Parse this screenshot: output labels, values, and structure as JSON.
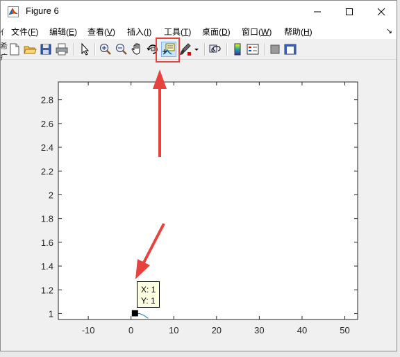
{
  "window": {
    "title": "Figure 6",
    "controls": {
      "minimize": "minimize",
      "maximize": "maximize",
      "close": "close"
    }
  },
  "menu": {
    "items": [
      {
        "label": "文件(",
        "key": "F",
        "end": ")"
      },
      {
        "label": "编辑(",
        "key": "E",
        "end": ")"
      },
      {
        "label": "查看(",
        "key": "V",
        "end": ")"
      },
      {
        "label": "插入(",
        "key": "I",
        "end": ")"
      },
      {
        "label": "工具(",
        "key": "T",
        "end": ")"
      },
      {
        "label": "桌面(",
        "key": "D",
        "end": ")"
      },
      {
        "label": "窗口(",
        "key": "W",
        "end": ")"
      },
      {
        "label": "帮助(",
        "key": "H",
        "end": ")"
      }
    ],
    "overflow_arrow": "↘"
  },
  "toolbar": {
    "buttons": [
      "new-figure-icon",
      "open-file-icon",
      "save-icon",
      "print-icon",
      "edit-plot-icon",
      "zoom-in-icon",
      "zoom-out-icon",
      "pan-icon",
      "rotate-3d-icon",
      "data-cursor-icon",
      "brush-icon",
      "link-plot-icon",
      "colorbar-icon",
      "legend-icon",
      "hide-plot-tools-icon",
      "show-plot-tools-icon"
    ],
    "active": "data-cursor-icon",
    "highlight_color": "#e8423f"
  },
  "chart_data": {
    "type": "line",
    "title": "",
    "xlabel": "",
    "ylabel": "",
    "xlim": [
      -17,
      53
    ],
    "ylim": [
      0.95,
      2.95
    ],
    "xticks": [
      -10,
      0,
      10,
      20,
      30,
      40,
      50
    ],
    "yticks": [
      1,
      1.2,
      1.4,
      1.6,
      1.8,
      2,
      2.2,
      2.4,
      2.6,
      2.8
    ],
    "ytick_labels": [
      "1",
      "1.2",
      "1.4",
      "1.6",
      "1.8",
      "2",
      "2.2",
      "2.4",
      "2.6",
      "2.8"
    ],
    "grid": false,
    "series": [
      {
        "x": [
          1,
          2,
          3,
          4
        ],
        "y": [
          1,
          1,
          0.985,
          0.96
        ],
        "color": "#0072bd"
      }
    ],
    "datatip": {
      "x": 1,
      "y": 1,
      "x_text": "X: 1",
      "y_text": "Y: 1"
    }
  },
  "side_fragments": [
    "亻",
    "希",
    "疒"
  ]
}
